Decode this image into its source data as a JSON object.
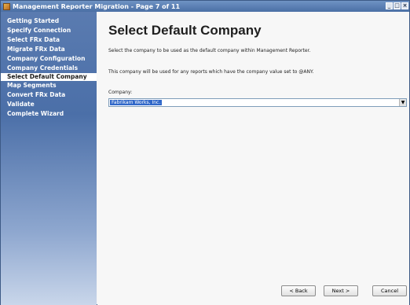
{
  "window": {
    "title": "Management Reporter Migration - Page 7 of 11"
  },
  "sidebar": {
    "items": [
      {
        "label": "Getting Started"
      },
      {
        "label": "Specify Connection"
      },
      {
        "label": "Select FRx Data"
      },
      {
        "label": "Migrate FRx Data"
      },
      {
        "label": "Company Configuration"
      },
      {
        "label": "Company Credentials"
      },
      {
        "label": "Select Default Company",
        "active": true
      },
      {
        "label": "Map Segments"
      },
      {
        "label": "Convert FRx Data"
      },
      {
        "label": "Validate"
      },
      {
        "label": "Complete Wizard"
      }
    ]
  },
  "main": {
    "title": "Select Default Company",
    "description_1": "Select the company to be used as the default company within Management Reporter.",
    "description_2": "This company will be used for any reports which have the company value set to @ANY.",
    "company_label": "Company:",
    "company_value": "Fabrikam Works, Inc."
  },
  "footer": {
    "back_label": "< Back",
    "next_label": "Next >",
    "cancel_label": "Cancel"
  },
  "colors": {
    "sidebar_top": "#5a7bb0",
    "sidebar_bottom": "#c9d6ea",
    "selection": "#3168c9"
  }
}
